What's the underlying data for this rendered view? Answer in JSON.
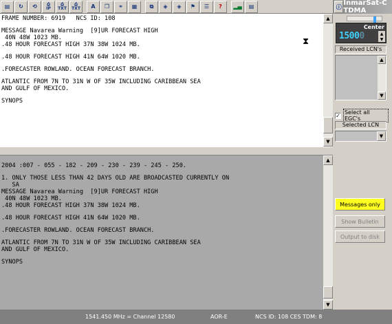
{
  "toolbar": {
    "buttons": [
      {
        "icon": "open-folder-icon",
        "glyph": "▤"
      },
      {
        "icon": "refresh-icon",
        "glyph": "↻"
      },
      {
        "icon": "database-refresh-icon",
        "glyph": "⟲"
      },
      {
        "icon": "ip-print-icon",
        "glyph": "⎙",
        "caption": "IP"
      },
      {
        "icon": "print-text-icon",
        "glyph": "⎙",
        "caption": "TXT"
      },
      {
        "icon": "print-text-alt-icon",
        "glyph": "⎙",
        "caption": "TXT"
      },
      {
        "icon": "font-icon",
        "glyph": "A"
      },
      {
        "icon": "windows-icon",
        "glyph": "❐"
      },
      {
        "icon": "binoculars-icon",
        "glyph": "⚭"
      },
      {
        "icon": "grid-table-icon",
        "glyph": "▦"
      },
      {
        "icon": "copy-icon",
        "glyph": "⧉"
      },
      {
        "icon": "shield-icon",
        "glyph": "◈"
      },
      {
        "icon": "shield-alt-icon",
        "glyph": "◈"
      },
      {
        "icon": "flag-icon",
        "glyph": "⚑"
      },
      {
        "icon": "list-icon",
        "glyph": "☰"
      },
      {
        "icon": "help-icon",
        "glyph": "?"
      },
      {
        "icon": "signal-meter-icon",
        "glyph": "▂▄"
      },
      {
        "icon": "device-icon",
        "glyph": "▤"
      },
      {
        "icon": "info-icon",
        "glyph": "ⓘ"
      }
    ]
  },
  "window": {
    "title": "InmarSat-C TDMA"
  },
  "upper_pane": {
    "lines": [
      "FRAME NUMBER: 6919   NCS ID: 108",
      "",
      "MESSAGE Navarea Warning  [9]UR FORECAST HIGH",
      " 40N 48W 1023 MB.",
      ".48 HOUR FORECAST HIGH 37N 38W 1024 MB.",
      "",
      ".48 HOUR FORECAST HIGH 41N 64W 1020 MB.",
      "",
      ".FORECASTER ROWLAND. OCEAN FORECAST BRANCH.",
      "",
      "ATLANTIC FROM 7N TO 31N W OF 35W INCLUDING CARIBBEAN SEA",
      "AND GULF OF MEXICO.",
      "",
      "SYNOPS"
    ],
    "hourglass_icon": "hourglass-icon"
  },
  "lower_pane": {
    "lines": [
      "",
      "2004 :007 - 055 - 182 - 209 - 230 - 239 - 245 - 250.",
      "",
      "1. ONLY THOSE LESS THAN 42 DAYS OLD ARE BROADCASTED CURRENTLY ON",
      "   SA",
      "MESSAGE Navarea Warning  [9]UR FORECAST HIGH",
      " 40N 48W 1023 MB.",
      ".48 HOUR FORECAST HIGH 37N 38W 1024 MB.",
      "",
      ".48 HOUR FORECAST HIGH 41N 64W 1020 MB.",
      "",
      ".FORECASTER ROWLAND. OCEAN FORECAST BRANCH.",
      "",
      "ATLANTIC FROM 7N TO 31N W OF 35W INCLUDING CARIBBEAN SEA",
      "AND GULF OF MEXICO.",
      "",
      "SYNOPS"
    ]
  },
  "tuning": {
    "center_label": "Center",
    "digits_bright": "1500",
    "digits_dim": "0"
  },
  "side": {
    "received_lcns_label": "Received LCN's",
    "select_all_label": "Select all EGC's",
    "select_all_checked": "✓",
    "selected_lcn_label": "Selected LCN",
    "messages_only": "Messages only",
    "show_bulletin": "Show Bulletin",
    "output_to_disk": "Output to disk"
  },
  "status": {
    "frequency": "1541.450 MHz = Channel 12580",
    "satellite": "AOR-E",
    "ncs": "NCS ID: 108 CES TDM: 8"
  },
  "colors": {
    "accent_freq": "#3fd0ff",
    "active_button": "#ffff20",
    "lower_pane_bg": "#a9a9a9"
  }
}
